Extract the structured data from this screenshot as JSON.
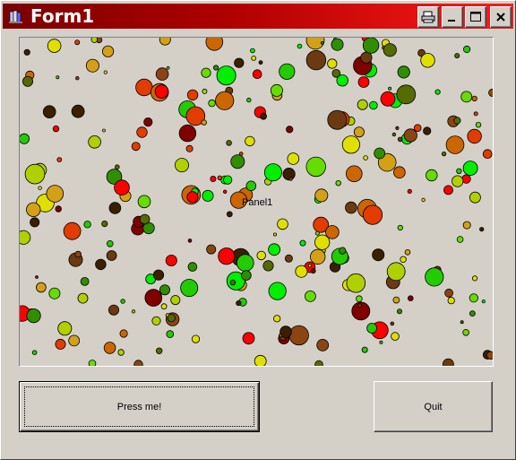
{
  "window": {
    "title": "Form1",
    "controls": {
      "restore_icon": "printer-icon",
      "minimize_icon": "minimize-icon",
      "maximize_icon": "maximize-icon",
      "close_icon": "close-icon"
    }
  },
  "panel": {
    "caption": "Panel1"
  },
  "buttons": {
    "press_label": "Press me!",
    "quit_label": "Quit"
  },
  "colors": {
    "title_gradient_start": "#7a0000",
    "title_gradient_end": "#ff1a1a",
    "face": "#d4d0c8",
    "bubble_palette": [
      "#ff0000",
      "#e23c00",
      "#cc6600",
      "#d4a017",
      "#e0e000",
      "#b0d000",
      "#66dd00",
      "#22cc00",
      "#00ee00",
      "#2f8f00",
      "#556b00",
      "#8b4513",
      "#6b3a10",
      "#3a2000",
      "#800000"
    ]
  }
}
